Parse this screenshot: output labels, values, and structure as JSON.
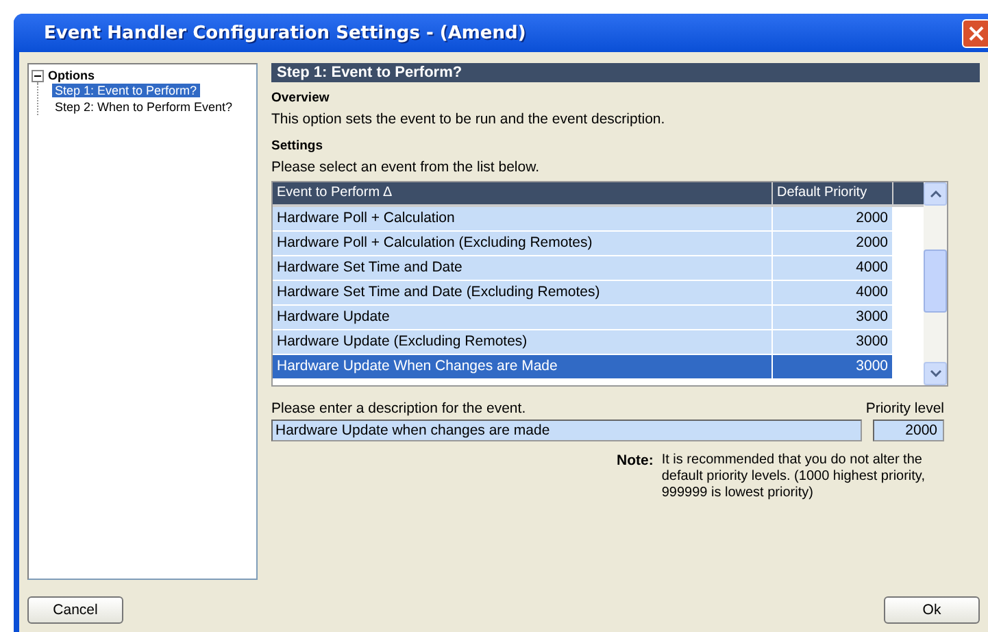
{
  "window": {
    "title": "Event Handler Configuration Settings - (Amend)"
  },
  "tree": {
    "label": "Options",
    "expanded": true,
    "children": [
      {
        "label": "Step 1: Event to Perform?",
        "selected": true
      },
      {
        "label": "Step 2: When to Perform Event?",
        "selected": false
      }
    ]
  },
  "step_header": "Step 1: Event to Perform?",
  "overview": {
    "heading": "Overview",
    "text": "This option sets the event to be run and the event description."
  },
  "settings": {
    "heading": "Settings",
    "text": "Please select an event from the list below."
  },
  "table": {
    "columns": [
      "Event to Perform ∆",
      "Default Priority"
    ],
    "rows": [
      {
        "event": "Hardware Poll + Calculation",
        "priority": "2000",
        "selected": false
      },
      {
        "event": "Hardware Poll + Calculation (Excluding Remotes)",
        "priority": "2000",
        "selected": false
      },
      {
        "event": "Hardware Set Time and Date",
        "priority": "4000",
        "selected": false
      },
      {
        "event": "Hardware Set Time and Date (Excluding Remotes)",
        "priority": "4000",
        "selected": false
      },
      {
        "event": "Hardware Update",
        "priority": "3000",
        "selected": false
      },
      {
        "event": "Hardware Update (Excluding Remotes)",
        "priority": "3000",
        "selected": false
      },
      {
        "event": "Hardware Update When Changes are Made",
        "priority": "3000",
        "selected": true
      }
    ]
  },
  "description": {
    "label": "Please enter a description for the event.",
    "value": "Hardware Update when changes are made"
  },
  "priority": {
    "label": "Priority level",
    "value": "2000"
  },
  "note": {
    "label": "Note:",
    "text": "It is recommended that you do not alter the default priority levels. (1000 highest priority, 999999 is lowest priority)"
  },
  "buttons": {
    "cancel": "Cancel",
    "ok": "Ok"
  }
}
